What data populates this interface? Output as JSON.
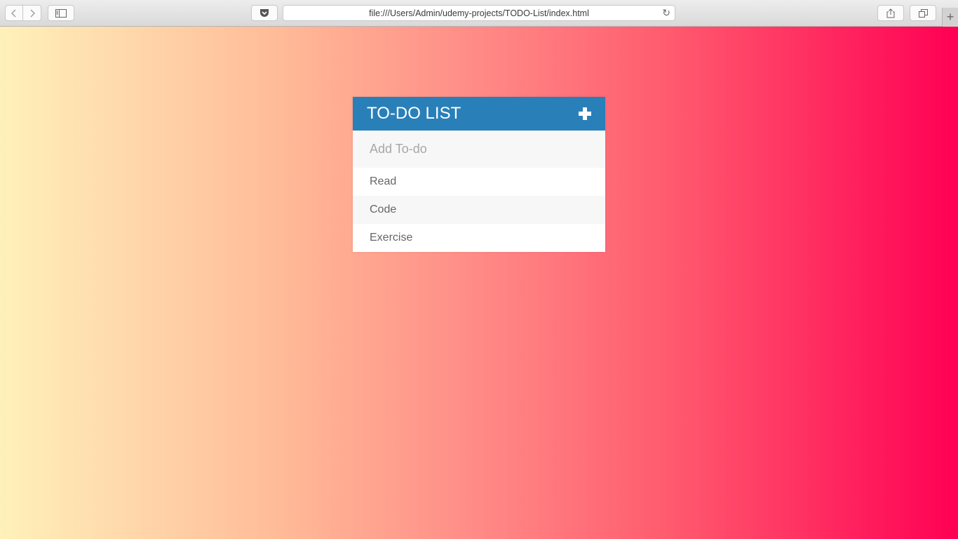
{
  "browser": {
    "url": "file:///Users/Admin/udemy-projects/TODO-List/index.html"
  },
  "todo": {
    "title": "TO-DO LIST",
    "input_placeholder": "Add To-do",
    "input_value": "",
    "items": [
      {
        "label": "Read"
      },
      {
        "label": "Code"
      },
      {
        "label": "Exercise"
      }
    ]
  },
  "colors": {
    "header": "#2980b9",
    "gradient_start": "#fff1ba",
    "gradient_end": "#ff0054"
  },
  "icons": {
    "add": "plus-icon",
    "back": "chevron-left-icon",
    "forward": "chevron-right-icon",
    "sidebar": "sidebar-icon",
    "pocket": "pocket-icon",
    "reload": "reload-icon",
    "share": "share-icon",
    "tabs": "tabs-icon",
    "new_tab": "plus-icon"
  }
}
